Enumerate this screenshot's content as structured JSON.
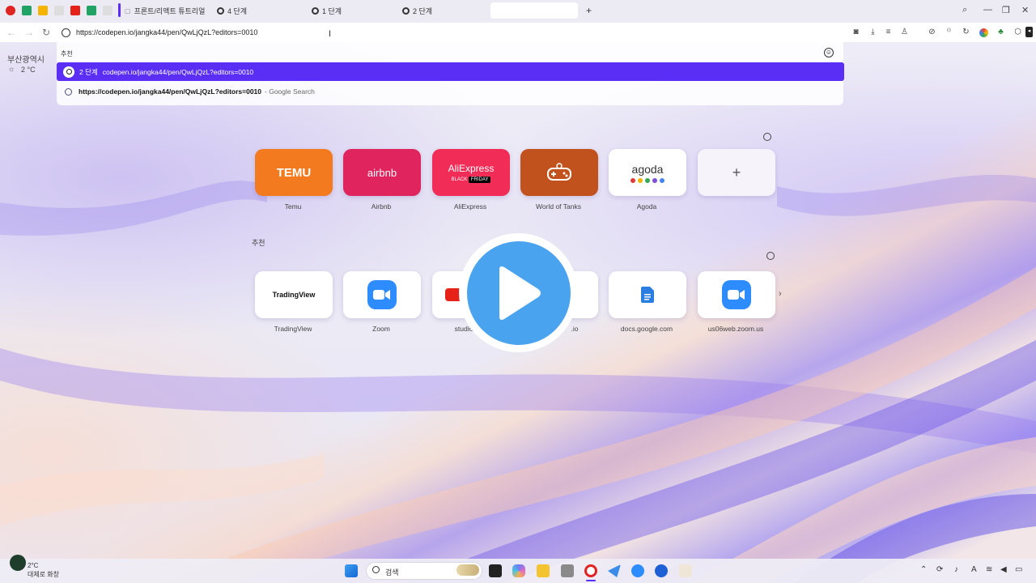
{
  "tabs": {
    "items": [
      {
        "label": "프론트/리액트 튜트리얼"
      },
      {
        "label": "4 단계"
      },
      {
        "label": "1 단계"
      },
      {
        "label": "2 단계"
      }
    ],
    "new_tab": "+"
  },
  "address_bar": {
    "url": "https://codepen.io/jangka44/pen/QwLjQzL?editors=0010"
  },
  "suggestions": {
    "header": "추천",
    "primary": {
      "title": "2 단계",
      "url": "codepen.io/jangka44/pen/QwLjQzL?editors=0010"
    },
    "search": {
      "query": "https://codepen.io/jangka44/pen/QwLjQzL?editors=0010",
      "engine": "- Google Search"
    }
  },
  "weather": {
    "city": "부산광역시",
    "temp": "2 °C"
  },
  "speed_dial": {
    "top": [
      {
        "label": "Temu",
        "logo": "TEMU",
        "color": "#f47a1f"
      },
      {
        "label": "Airbnb",
        "logo": "airbnb",
        "color": "#e0245e"
      },
      {
        "label": "AliExpress",
        "logo": "AliExpress",
        "badge_left": "BLACK",
        "badge_right": "FRIDAY",
        "color": "#f02c57"
      },
      {
        "label": "World of Tanks",
        "logo": "game-controller-icon",
        "color": "#c2521d"
      },
      {
        "label": "Agoda",
        "logo": "agoda",
        "color": "#ffffff"
      },
      {
        "label": "",
        "logo": "+",
        "color": "#f6f3fb"
      }
    ],
    "section_label": "추천",
    "bottom": [
      {
        "label": "TradingView",
        "logo": "TradingView"
      },
      {
        "label": "Zoom",
        "logo": "zoom-camera-icon"
      },
      {
        "label": "studio.you",
        "logo": "youtube-icon"
      },
      {
        "label": ".io",
        "logo": ""
      },
      {
        "label": "docs.google.com",
        "logo": "google-docs-icon"
      },
      {
        "label": "us06web.zoom.us",
        "logo": "zoom-camera-icon"
      }
    ]
  },
  "taskbar": {
    "search_placeholder": "검색",
    "weather_temp": "2°C",
    "weather_desc": "대체로 화창"
  }
}
